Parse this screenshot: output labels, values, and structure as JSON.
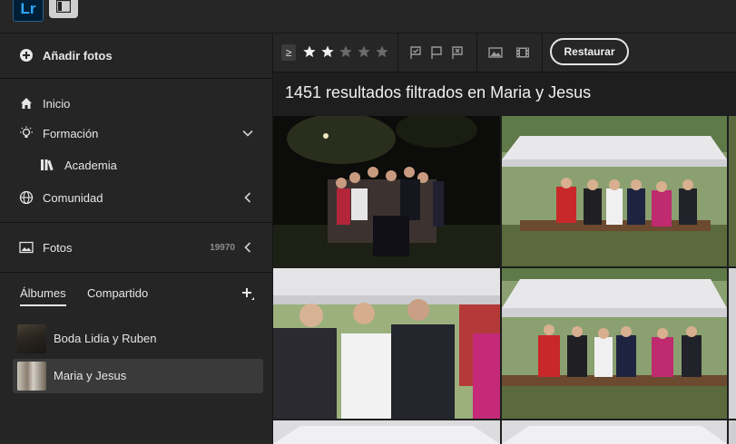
{
  "app": {
    "logo_text": "Lr"
  },
  "sidebar": {
    "add_photos": "Añadir fotos",
    "nav": [
      {
        "label": "Inicio"
      },
      {
        "label": "Formación"
      },
      {
        "label": "Academia"
      },
      {
        "label": "Comunidad"
      }
    ],
    "photos": {
      "label": "Fotos",
      "count": "19970"
    },
    "album_tabs": [
      {
        "label": "Álbumes",
        "active": true
      },
      {
        "label": "Compartido",
        "active": false
      }
    ],
    "albums": [
      {
        "name": "Boda Lidia y Ruben",
        "selected": false
      },
      {
        "name": "Maria y Jesus",
        "selected": true
      }
    ]
  },
  "filterbar": {
    "ge_label": "≥",
    "stars_filled": 2,
    "stars_total": 5,
    "restore_label": "Restaurar"
  },
  "main": {
    "results_text": "1451 resultados filtrados en Maria y Jesus"
  },
  "colors": {
    "background": "#1e1e1e",
    "panel": "#252525",
    "lr_blue": "#31a8ff",
    "lr_dark": "#001e36"
  }
}
